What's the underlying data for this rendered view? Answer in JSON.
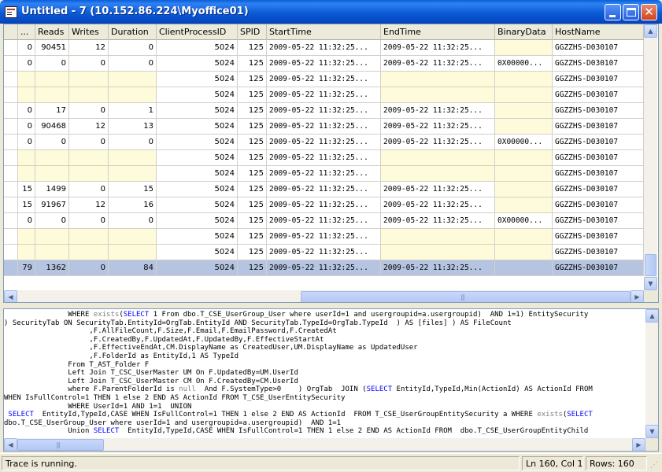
{
  "window": {
    "title": "Untitled - 7 (10.152.86.224\\Myoffice01)",
    "close_glyph": "✕"
  },
  "grid": {
    "columns": [
      "...",
      "Reads",
      "Writes",
      "Duration",
      "ClientProcessID",
      "SPID",
      "StartTime",
      "EndTime",
      "BinaryData",
      "HostName"
    ],
    "rows": [
      {
        "c0": "0",
        "reads": "90451",
        "writes": "12",
        "duration": "0",
        "cpid": "5024",
        "spid": "125",
        "start": "2009-05-22 11:32:25...",
        "end": "2009-05-22 11:32:25...",
        "binary": "",
        "host": "GGZZHS-D030107"
      },
      {
        "c0": "0",
        "reads": "0",
        "writes": "0",
        "duration": "0",
        "cpid": "5024",
        "spid": "125",
        "start": "2009-05-22 11:32:25...",
        "end": "2009-05-22 11:32:25...",
        "binary": "0X00000...",
        "host": "GGZZHS-D030107"
      },
      {
        "c0": "",
        "reads": "",
        "writes": "",
        "duration": "",
        "cpid": "5024",
        "spid": "125",
        "start": "2009-05-22 11:32:25...",
        "end": "",
        "binary": "",
        "host": "GGZZHS-D030107"
      },
      {
        "c0": "",
        "reads": "",
        "writes": "",
        "duration": "",
        "cpid": "5024",
        "spid": "125",
        "start": "2009-05-22 11:32:25...",
        "end": "",
        "binary": "",
        "host": "GGZZHS-D030107"
      },
      {
        "c0": "0",
        "reads": "17",
        "writes": "0",
        "duration": "1",
        "cpid": "5024",
        "spid": "125",
        "start": "2009-05-22 11:32:25...",
        "end": "2009-05-22 11:32:25...",
        "binary": "",
        "host": "GGZZHS-D030107"
      },
      {
        "c0": "0",
        "reads": "90468",
        "writes": "12",
        "duration": "13",
        "cpid": "5024",
        "spid": "125",
        "start": "2009-05-22 11:32:25...",
        "end": "2009-05-22 11:32:25...",
        "binary": "",
        "host": "GGZZHS-D030107"
      },
      {
        "c0": "0",
        "reads": "0",
        "writes": "0",
        "duration": "0",
        "cpid": "5024",
        "spid": "125",
        "start": "2009-05-22 11:32:25...",
        "end": "2009-05-22 11:32:25...",
        "binary": "0X00000...",
        "host": "GGZZHS-D030107"
      },
      {
        "c0": "",
        "reads": "",
        "writes": "",
        "duration": "",
        "cpid": "5024",
        "spid": "125",
        "start": "2009-05-22 11:32:25...",
        "end": "",
        "binary": "",
        "host": "GGZZHS-D030107"
      },
      {
        "c0": "",
        "reads": "",
        "writes": "",
        "duration": "",
        "cpid": "5024",
        "spid": "125",
        "start": "2009-05-22 11:32:25...",
        "end": "",
        "binary": "",
        "host": "GGZZHS-D030107"
      },
      {
        "c0": "15",
        "reads": "1499",
        "writes": "0",
        "duration": "15",
        "cpid": "5024",
        "spid": "125",
        "start": "2009-05-22 11:32:25...",
        "end": "2009-05-22 11:32:25...",
        "binary": "",
        "host": "GGZZHS-D030107"
      },
      {
        "c0": "15",
        "reads": "91967",
        "writes": "12",
        "duration": "16",
        "cpid": "5024",
        "spid": "125",
        "start": "2009-05-22 11:32:25...",
        "end": "2009-05-22 11:32:25...",
        "binary": "",
        "host": "GGZZHS-D030107"
      },
      {
        "c0": "0",
        "reads": "0",
        "writes": "0",
        "duration": "0",
        "cpid": "5024",
        "spid": "125",
        "start": "2009-05-22 11:32:25...",
        "end": "2009-05-22 11:32:25...",
        "binary": "0X00000...",
        "host": "GGZZHS-D030107"
      },
      {
        "c0": "",
        "reads": "",
        "writes": "",
        "duration": "",
        "cpid": "5024",
        "spid": "125",
        "start": "2009-05-22 11:32:25...",
        "end": "",
        "binary": "",
        "host": "GGZZHS-D030107"
      },
      {
        "c0": "",
        "reads": "",
        "writes": "",
        "duration": "",
        "cpid": "5024",
        "spid": "125",
        "start": "2009-05-22 11:32:25...",
        "end": "",
        "binary": "",
        "host": "GGZZHS-D030107"
      },
      {
        "c0": "79",
        "reads": "1362",
        "writes": "0",
        "duration": "84",
        "cpid": "5024",
        "spid": "125",
        "start": "2009-05-22 11:32:25...",
        "end": "2009-05-22 11:32:25...",
        "binary": "",
        "host": "GGZZHS-D030107",
        "selected": true
      }
    ],
    "colors": {
      "empty_cell": "#fdfbda",
      "selected_row": "#b5c4e0"
    }
  },
  "sql": {
    "lines": [
      [
        [
          "t",
          "               WHERE "
        ],
        [
          "g",
          "exists"
        ],
        [
          "t",
          "("
        ],
        [
          "k",
          "SELECT"
        ],
        [
          "t",
          " 1 From dbo.T_CSE_UserGroup_User where userId=1 and usergroupid=a.usergroupid)  AND 1=1) EntitySecurity"
        ]
      ],
      [
        [
          "t",
          ") SecurityTab ON SecurityTab.EntityId=OrgTab.EntityId AND SecurityTab.TypeId=OrgTab.TypeId  ) AS [files] ) AS FileCount"
        ]
      ],
      [
        [
          "t",
          "                    ,F.AllFileCount,F.Size,F.Email,F.EmailPassword,F.CreatedAt"
        ]
      ],
      [
        [
          "t",
          "                    ,F.CreatedBy,F.UpdatedAt,F.UpdatedBy,F.EffectiveStartAt"
        ]
      ],
      [
        [
          "t",
          "                    ,F.EffectiveEndAt,CM.DisplayName as CreatedUser,UM.DisplayName as UpdatedUser"
        ]
      ],
      [
        [
          "t",
          "                    ,F.FolderId as EntityId,1 AS TypeId"
        ]
      ],
      [
        [
          "t",
          "               From T_AST_Folder F"
        ]
      ],
      [
        [
          "t",
          "               Left Join T_CSC_UserMaster UM On F.UpdatedBy=UM.UserId"
        ]
      ],
      [
        [
          "t",
          "               Left Join T_CSC_UserMaster CM On F.CreatedBy=CM.UserId"
        ]
      ],
      [
        [
          "t",
          "               where F.ParentFolderId is "
        ],
        [
          "g",
          "null"
        ],
        [
          "t",
          "  And F.SystemType>0    ) OrgTab  JOIN ("
        ],
        [
          "k",
          "SELECT"
        ],
        [
          "t",
          " EntityId,TypeId,Min(ActionId) AS ActionId FROM"
        ]
      ],
      [
        [
          "t",
          "WHEN IsFullControl=1 THEN 1 else 2 END AS ActionId FROM T_CSE_UserEntitySecurity"
        ]
      ],
      [
        [
          "t",
          "               WHERE UserId=1 AND 1=1  UNION"
        ]
      ],
      [
        [
          "t",
          " "
        ],
        [
          "k",
          "SELECT"
        ],
        [
          "t",
          "  EntityId,TypeId,CASE WHEN IsFullControl=1 THEN 1 else 2 END AS ActionId  FROM T_CSE_UserGroupEntitySecurity a WHERE "
        ],
        [
          "g",
          "exists"
        ],
        [
          "t",
          "("
        ],
        [
          "k",
          "SELECT"
        ]
      ],
      [
        [
          "t",
          "dbo.T_CSE_UserGroup_User where userId=1 and usergroupid=a.usergroupid)  AND 1=1"
        ]
      ],
      [
        [
          "t",
          "               Union "
        ],
        [
          "k",
          "SELECT"
        ],
        [
          "t",
          "  EntityId,TypeId,CASE WHEN IsFullControl=1 THEN 1 else 2 END AS ActionId FROM  dbo.T_CSE_UserGroupEntityChild"
        ]
      ]
    ],
    "colors": {
      "keyword": "#0000ff",
      "function": "#808080"
    }
  },
  "status": {
    "message": "Trace is running.",
    "position": "Ln 160, Col 1",
    "rows": "Rows: 160"
  }
}
